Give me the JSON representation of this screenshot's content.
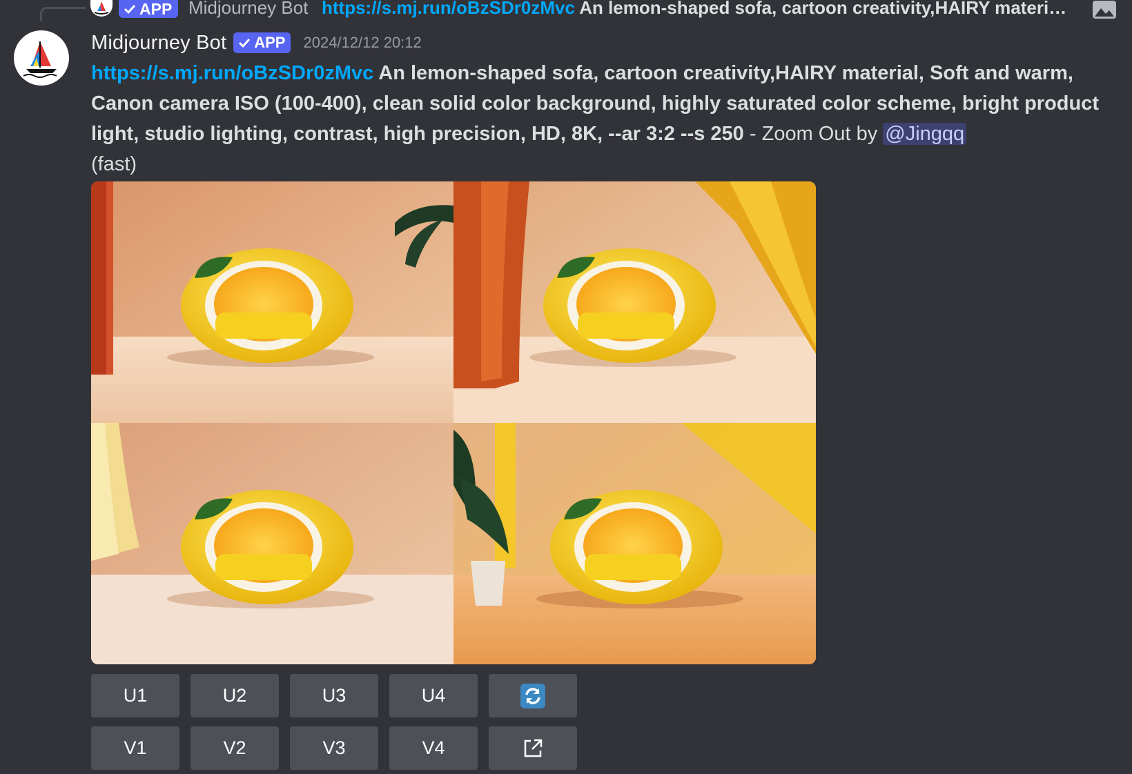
{
  "reply": {
    "app_badge": "APP",
    "author": "Midjourney Bot",
    "link": "https://s.mj.run/oBzSDr0zMvc",
    "text": " An lemon-shaped sofa, cartoon creativity,HAIRY materi…"
  },
  "message": {
    "author": "Midjourney Bot",
    "app_badge": "APP",
    "timestamp": "2024/12/12 20:12",
    "link": "https://s.mj.run/oBzSDr0zMvc",
    "prompt": " An lemon-shaped sofa, cartoon creativity,HAIRY material, Soft and warm, Canon camera ISO (100-400), clean solid color background, highly saturated color scheme, bright product light, studio lighting, contrast, high precision, HD, 8K, --ar 3:2 --s 250",
    "suffix": " - Zoom Out by ",
    "mention": "@Jingqq",
    "mode": "(fast)"
  },
  "buttons": {
    "upscale": [
      "U1",
      "U2",
      "U3",
      "U4"
    ],
    "variation": [
      "V1",
      "V2",
      "V3",
      "V4"
    ],
    "reroll_icon": "refresh-icon",
    "web_icon": "external-link-icon"
  },
  "colors": {
    "background": "#323338",
    "link": "#00a8fc",
    "badge": "#5865f2",
    "button": "#4e5058"
  }
}
